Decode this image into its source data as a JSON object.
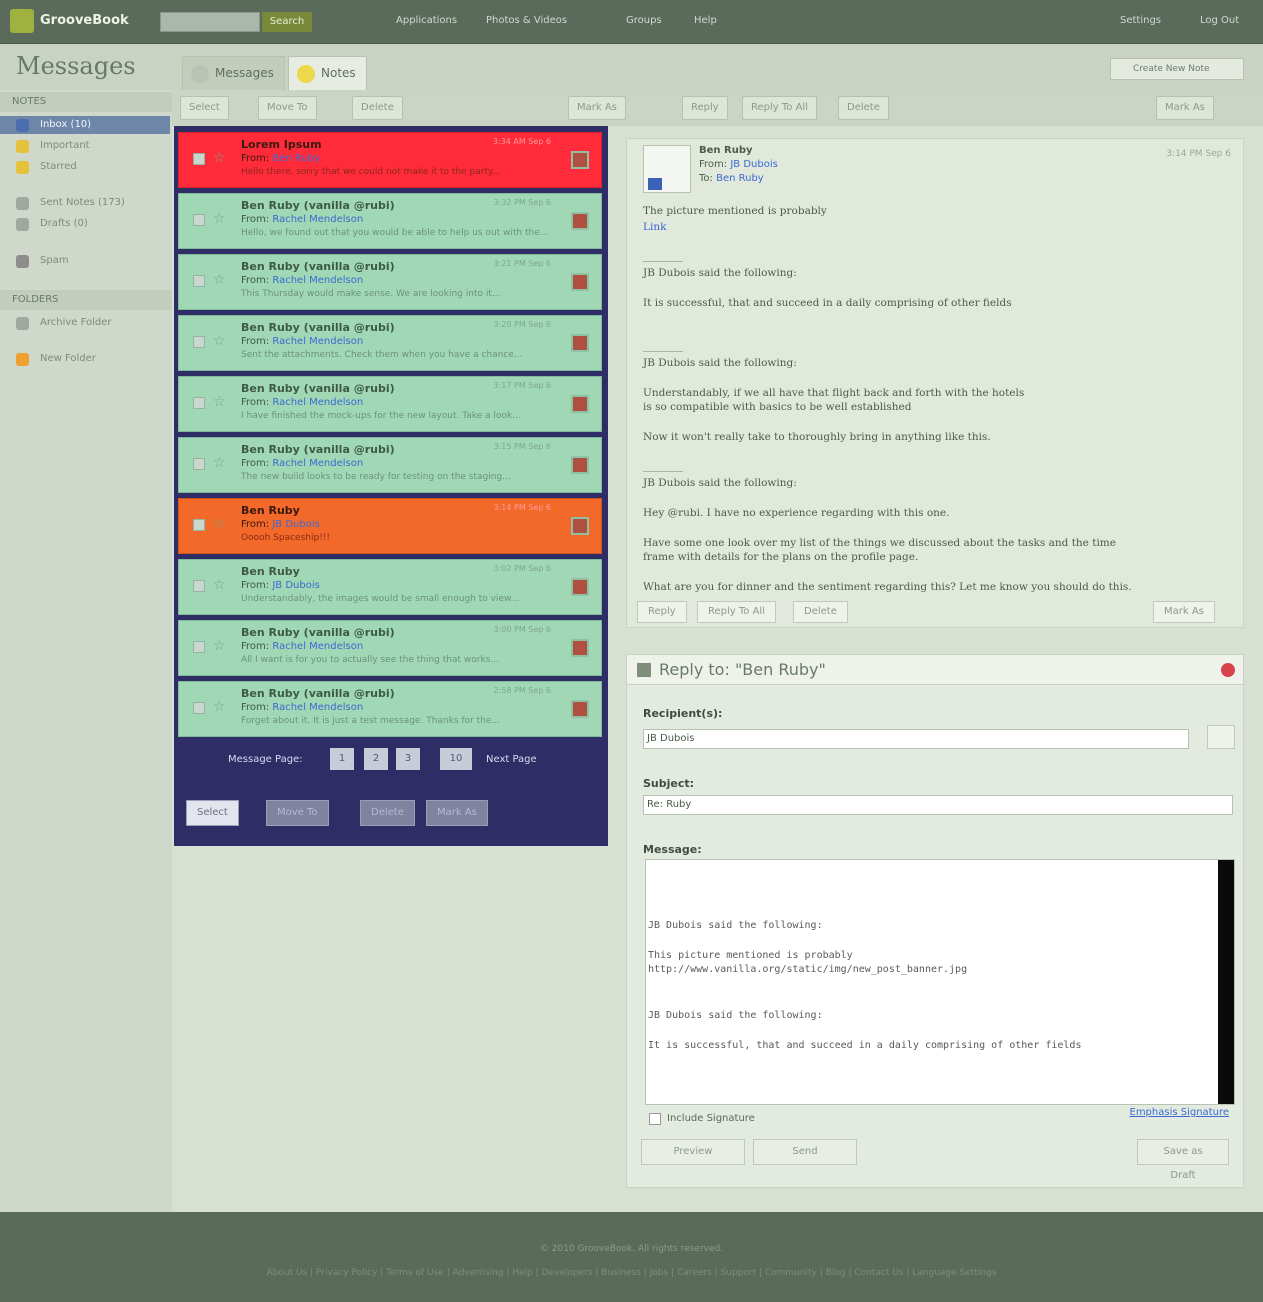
{
  "app": {
    "name": "GrooveBook"
  },
  "topbar": {
    "search_button": "Search",
    "nav": [
      "Applications",
      "Photos & Videos",
      "Groups",
      "Help"
    ],
    "right_links": [
      "Settings",
      "Log Out"
    ]
  },
  "page_title": "Messages",
  "tabs": [
    {
      "label": "Messages"
    },
    {
      "label": "Notes"
    }
  ],
  "create_new": "Create New Note",
  "sidebar": {
    "section1_title": "NOTES",
    "items": [
      {
        "label": "Inbox (10)",
        "color": "#4b6db0"
      },
      {
        "label": "Important",
        "color": "#e4c23a"
      },
      {
        "label": "Starred",
        "color": "#e4c23a"
      },
      {
        "label": "Sent Notes (173)",
        "color": "#9fa99f"
      },
      {
        "label": "Drafts (0)",
        "color": "#9fa99f"
      },
      {
        "label": "Spam",
        "color": "#8d8d8d"
      }
    ],
    "section2_title": "FOLDERS",
    "folder_items": [
      {
        "label": "Archive Folder",
        "color": "#a0a9a0"
      },
      {
        "label": "New Folder",
        "color": "#f0a030"
      }
    ]
  },
  "toolbar": {
    "select": "Select",
    "move_to": "Move To",
    "delete": "Delete",
    "mark_as": "Mark As",
    "reply": "Reply",
    "reply_to_all": "Reply To All",
    "forward": "Delete",
    "mark_as_right": "Mark As"
  },
  "messages": [
    {
      "subject": "Lorem Ipsum",
      "from_label": "From:",
      "from": "Ben Ruby",
      "preview": "Hello there, sorry that we could not make it to the party...",
      "time": "3:34 AM Sep 6",
      "style": "red"
    },
    {
      "subject": "Ben Ruby (vanilla @rubi)",
      "from_label": "From:",
      "from": "Rachel Mendelson",
      "preview": "Hello, we found out that you would be able to help us out with the...",
      "time": "3:32 PM Sep 6",
      "style": "green"
    },
    {
      "subject": "Ben Ruby (vanilla @rubi)",
      "from_label": "From:",
      "from": "Rachel Mendelson",
      "preview": "This Thursday would make sense. We are looking into it...",
      "time": "3:21 PM Sep 6",
      "style": "green"
    },
    {
      "subject": "Ben Ruby (vanilla @rubi)",
      "from_label": "From:",
      "from": "Rachel Mendelson",
      "preview": "Sent the attachments. Check them when you have a chance...",
      "time": "3:20 PM Sep 6",
      "style": "green"
    },
    {
      "subject": "Ben Ruby (vanilla @rubi)",
      "from_label": "From:",
      "from": "Rachel Mendelson",
      "preview": "I have finished the mock-ups for the new layout. Take a look...",
      "time": "3:17 PM Sep 6",
      "style": "green"
    },
    {
      "subject": "Ben Ruby (vanilla @rubi)",
      "from_label": "From:",
      "from": "Rachel Mendelson",
      "preview": "The new build looks to be ready for testing on the staging...",
      "time": "3:15 PM Sep 6",
      "style": "green"
    },
    {
      "subject": "Ben Ruby",
      "from_label": "From:",
      "from": "JB Dubois",
      "preview": "Ooooh Spaceship!!!",
      "time": "3:14 PM Sep 6",
      "style": "orange"
    },
    {
      "subject": "Ben Ruby",
      "from_label": "From:",
      "from": "JB Dubois",
      "preview": "Understandably, the images would be small enough to view...",
      "time": "3:02 PM Sep 6",
      "style": "green"
    },
    {
      "subject": "Ben Ruby (vanilla @rubi)",
      "from_label": "From:",
      "from": "Rachel Mendelson",
      "preview": "All I want is for you to actually see the thing that works...",
      "time": "3:00 PM Sep 6",
      "style": "green"
    },
    {
      "subject": "Ben Ruby (vanilla @rubi)",
      "from_label": "From:",
      "from": "Rachel Mendelson",
      "preview": "Forget about it. It is just a test message. Thanks for the...",
      "time": "2:58 PM Sep 6",
      "style": "green"
    }
  ],
  "pager": {
    "label": "Message Page:",
    "pages": [
      "1",
      "2",
      "3",
      "10"
    ],
    "per_page": "Next Page"
  },
  "list_buttons": {
    "select": "Select",
    "move_to": "Move To",
    "delete": "Delete",
    "mark_as": "Mark As"
  },
  "reader": {
    "title": "Ben Ruby",
    "from_label": "From:",
    "from": "JB Dubois",
    "to_label": "To:",
    "to": "Ben Ruby",
    "time": "3:14 PM Sep 6",
    "lines": [
      "The picture mentioned is probably",
      "Link",
      "JB Dubois said the following:",
      "It is successful, that and succeed in a daily comprising of other fields",
      "JB Dubois said the following:",
      "Understandably, if we all have that flight back and forth with the hotels",
      "is so compatible with basics to be well established",
      "Now it won't really take to thoroughly bring in anything like this.",
      "JB Dubois said the following:",
      "Hey @rubi. I have no experience regarding with this one.",
      "Have some one look over my list of the things we discussed about the tasks and the time",
      "frame with details for the plans on the profile page.",
      "What are you for dinner and the sentiment regarding this? Let me know you should do this."
    ],
    "reply": "Reply",
    "reply_all": "Reply To All",
    "delete": "Delete",
    "mark_as": "Mark As"
  },
  "reply_form": {
    "title": "Reply to: \"Ben Ruby\"",
    "recipients_label": "Recipient(s):",
    "recipients_value": "JB Dubois",
    "subject_label": "Subject:",
    "subject_value": "Re: Ruby",
    "message_label": "Message:",
    "message_lines": [
      "JB Dubois said the following:",
      "This picture mentioned is probably",
      "http://www.vanilla.org/static/img/new_post_banner.jpg",
      "JB Dubois said the following:",
      "It is successful, that and succeed in a daily comprising of other fields"
    ],
    "include_signature": "Include Signature",
    "signature_link": "Emphasis Signature",
    "preview": "Preview",
    "send": "Send",
    "save_draft": "Save as Draft"
  },
  "footer": {
    "copyright": "© 2010 GrooveBook. All rights reserved.",
    "links": "About Us | Privacy Policy | Terms of Use | Advertising | Help | Developers | Business | Jobs | Careers | Support | Community | Blog | Contact Us | Language Settings"
  }
}
